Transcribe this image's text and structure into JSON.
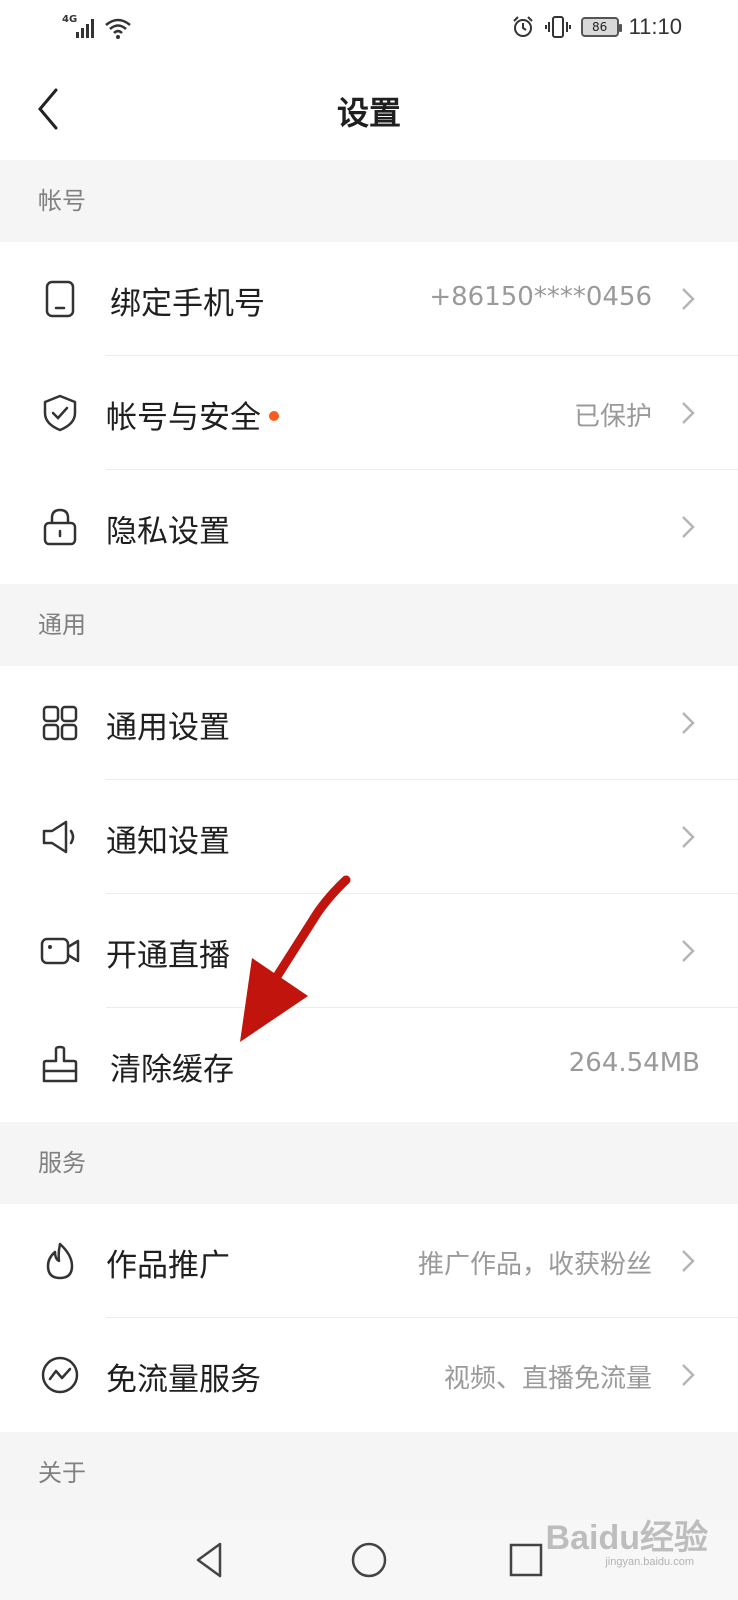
{
  "status_bar": {
    "network": "4G",
    "battery": "86",
    "time": "11:10"
  },
  "header": {
    "title": "设置"
  },
  "sections": {
    "account": {
      "title": "帐号",
      "items": [
        {
          "label": "绑定手机号",
          "value": "+86150****0456",
          "icon": "phone-icon"
        },
        {
          "label": "帐号与安全",
          "value": "已保护",
          "icon": "shield-icon"
        },
        {
          "label": "隐私设置",
          "value": "",
          "icon": "lock-icon"
        }
      ]
    },
    "general": {
      "title": "通用",
      "items": [
        {
          "label": "通用设置",
          "value": "",
          "icon": "grid-icon"
        },
        {
          "label": "通知设置",
          "value": "",
          "icon": "speaker-icon"
        },
        {
          "label": "开通直播",
          "value": "",
          "icon": "video-camera-icon"
        },
        {
          "label": "清除缓存",
          "value": "264.54MB",
          "icon": "brush-icon"
        }
      ]
    },
    "service": {
      "title": "服务",
      "items": [
        {
          "label": "作品推广",
          "value": "推广作品，收获粉丝",
          "icon": "flame-icon"
        },
        {
          "label": "免流量服务",
          "value": "视频、直播免流量",
          "icon": "traffic-icon"
        }
      ]
    },
    "about": {
      "title": "关于"
    }
  },
  "watermark": {
    "brand": "Baidu经验",
    "url": "jingyan.baidu.com"
  },
  "colors": {
    "accent_dot": "#fe5a1d",
    "annotation_arrow": "#c0140c",
    "section_bg": "#f5f5f5"
  }
}
